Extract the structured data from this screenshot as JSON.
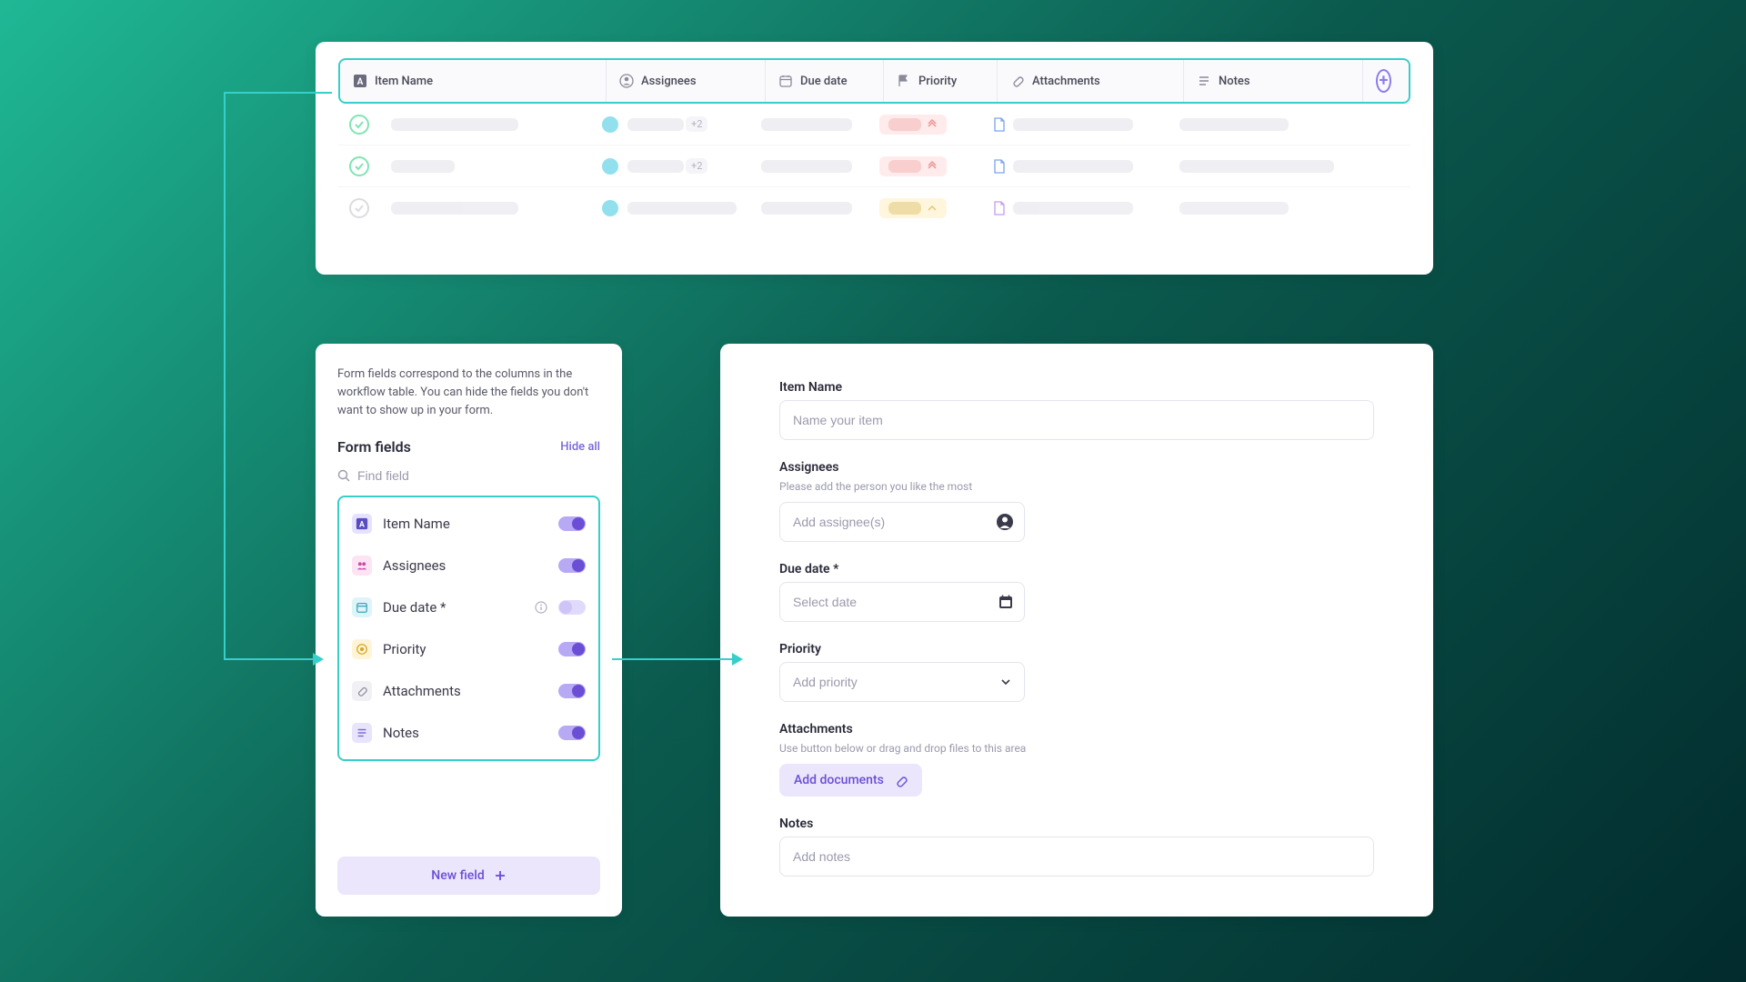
{
  "table": {
    "cols": {
      "item": "Item Name",
      "assignees": "Assignees",
      "due": "Due date",
      "priority": "Priority",
      "attachments": "Attachments",
      "notes": "Notes"
    },
    "rows": {
      "plus_tag": "+2"
    }
  },
  "panel": {
    "desc": "Form fields correspond to the columns in the workflow table. You can hide the fields you don't want to show up in your form.",
    "title": "Form fields",
    "hide_all": "Hide all",
    "search_placeholder": "Find field",
    "fields": [
      {
        "label": "Item Name",
        "icon": "text-icon",
        "bg": "#e4e2ff",
        "fg": "#5a4cbf",
        "on": true
      },
      {
        "label": "Assignees",
        "icon": "people-icon",
        "bg": "#fde4f5",
        "fg": "#c74aa2",
        "on": true
      },
      {
        "label": "Due date *",
        "icon": "calendar-icon",
        "bg": "#dff4f8",
        "fg": "#3da6bd",
        "on": false,
        "info": true
      },
      {
        "label": "Priority",
        "icon": "target-icon",
        "bg": "#fff4d6",
        "fg": "#d6a92a",
        "on": true
      },
      {
        "label": "Attachments",
        "icon": "paperclip-icon",
        "bg": "#f0f0f5",
        "fg": "#8a8a9a",
        "on": true
      },
      {
        "label": "Notes",
        "icon": "list-icon",
        "bg": "#e8e4fb",
        "fg": "#7a68d6",
        "on": true
      }
    ],
    "new_field": "New field"
  },
  "form": {
    "item_label": "Item Name",
    "item_ph": "Name your item",
    "assign_label": "Assignees",
    "assign_hint": "Please add the person you like the most",
    "assign_ph": "Add assignee(s)",
    "due_label": "Due date *",
    "due_ph": "Select date",
    "prio_label": "Priority",
    "prio_ph": "Add priority",
    "att_label": "Attachments",
    "att_hint": "Use button below or drag and drop files to this area",
    "att_btn": "Add documents",
    "notes_label": "Notes",
    "notes_ph": "Add notes"
  }
}
